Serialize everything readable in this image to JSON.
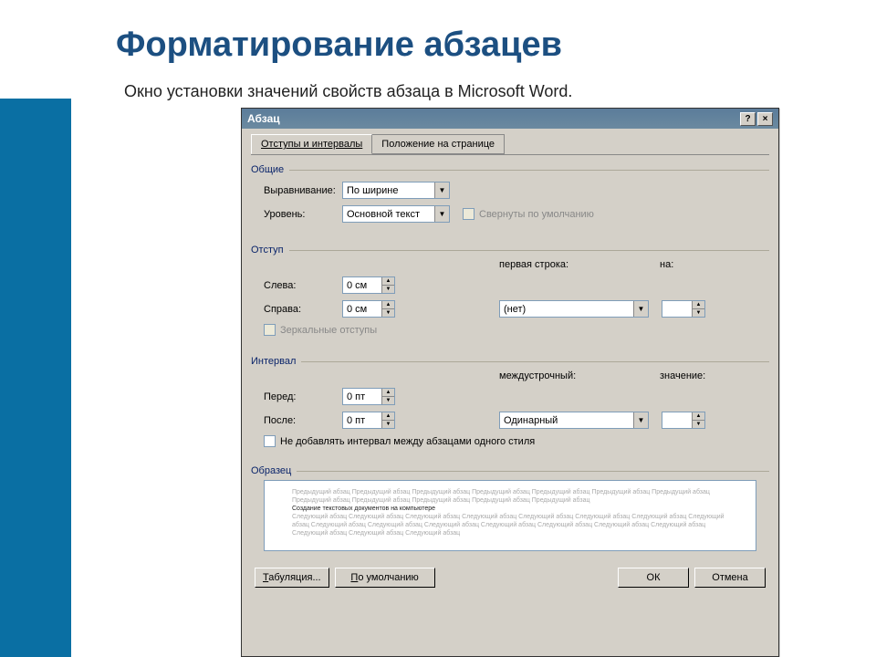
{
  "slide": {
    "title": "Форматирование абзацев",
    "subtitle": "Окно установки значений свойств абзаца в Microsoft Word."
  },
  "dialog": {
    "title": "Абзац",
    "help_btn": "?",
    "close_btn": "×",
    "tabs": {
      "indents": "Отступы и интервалы",
      "position": "Положение на странице"
    },
    "general": {
      "label": "Общие",
      "align_label": "Выравнивание:",
      "align_value": "По ширине",
      "level_label": "Уровень:",
      "level_value": "Основной текст",
      "collapse_label": "Свернуты по умолчанию"
    },
    "indent": {
      "label": "Отступ",
      "left_label": "Слева:",
      "left_value": "0 см",
      "right_label": "Справа:",
      "right_value": "0 см",
      "first_line_label": "первая строка:",
      "first_value": "(нет)",
      "by_label": "на:",
      "mirror_label": "Зеркальные отступы"
    },
    "interval": {
      "label": "Интервал",
      "before_label": "Перед:",
      "before_value": "0 пт",
      "after_label": "После:",
      "after_value": "0 пт",
      "line_label": "междустрочный:",
      "line_value": "Одинарный",
      "value_label": "значение:",
      "noadd_label": "Не добавлять интервал между абзацами одного стиля"
    },
    "preview": {
      "label": "Образец",
      "light": "Предыдущий абзац Предыдущий абзац Предыдущий абзац Предыдущий абзац Предыдущий абзац Предыдущий абзац Предыдущий абзац Предыдущий абзац Предыдущий абзац Предыдущий абзац Предыдущий абзац Предыдущий абзац",
      "dark": "Создание текстовых документов на компьютере",
      "light2": "Следующий абзац Следующий абзац Следующий абзац Следующий абзац Следующий абзац Следующий абзац Следующий абзац Следующий абзац Следующий абзац Следующий абзац Следующий абзац Следующий абзац Следующий абзац Следующий абзац Следующий абзац Следующий абзац Следующий абзац Следующий абзац"
    },
    "buttons": {
      "tabs": "Табуляция...",
      "default": "По умолчанию",
      "ok": "ОК",
      "cancel": "Отмена"
    }
  }
}
